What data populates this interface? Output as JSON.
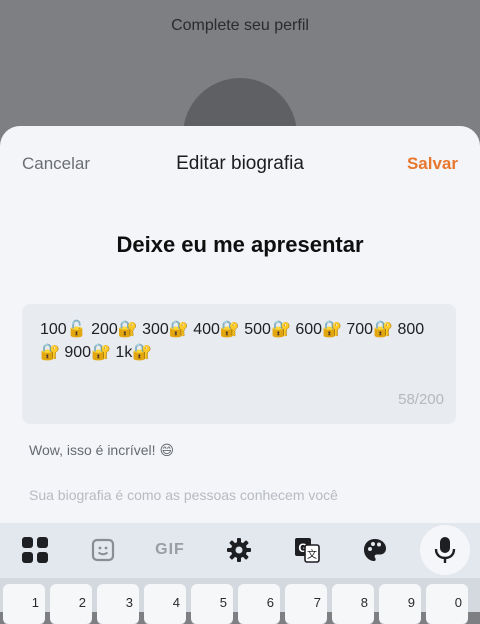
{
  "background": {
    "screen_title": "Complete seu perfil"
  },
  "header": {
    "cancel_label": "Cancelar",
    "title": "Editar biografia",
    "save_label": "Salvar"
  },
  "heading": "Deixe eu me apresentar",
  "bio": {
    "value": "100🔓 200🔐 300🔐 400🔐 500🔐 600🔐 700🔐 800🔐 900🔐 1k🔐",
    "counter": "58/200"
  },
  "hint": "Wow, isso é incrível! 😄",
  "placeholder": "Sua biografia é como as pessoas conhecem você",
  "keyboard": {
    "toolbar_icons": [
      "apps-grid-icon",
      "sticker-icon",
      "gif-icon",
      "gear-icon",
      "translate-icon",
      "palette-icon",
      "mic-icon"
    ],
    "gif_label": "GIF",
    "number_keys": [
      "1",
      "2",
      "3",
      "4",
      "5",
      "6",
      "7",
      "8",
      "9",
      "0"
    ]
  },
  "colors": {
    "accent": "#e8772e",
    "sheet": "#f3f5f9",
    "overlay": "#7d7f83"
  }
}
